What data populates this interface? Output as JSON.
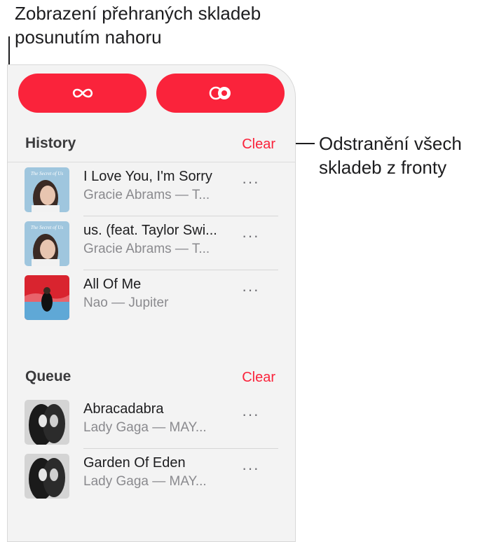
{
  "callouts": {
    "top": "Zobrazení přehraných skladeb posunutím nahoru",
    "right": "Odstranění všech skladeb z fronty"
  },
  "top_buttons": [
    {
      "icon": "infinity-icon"
    },
    {
      "icon": "autoplay-icon"
    }
  ],
  "history": {
    "title": "History",
    "clear_label": "Clear",
    "items": [
      {
        "title": "I Love You, I'm Sorry",
        "subtitle": "Gracie Abrams — T...",
        "more": "···"
      },
      {
        "title": "us. (feat. Taylor Swi...",
        "subtitle": "Gracie Abrams — T...",
        "more": "···"
      },
      {
        "title": "All Of Me",
        "subtitle": "Nao — Jupiter",
        "more": "···"
      }
    ]
  },
  "queue": {
    "title": "Queue",
    "clear_label": "Clear",
    "items": [
      {
        "title": "Abracadabra",
        "subtitle": "Lady Gaga — MAY...",
        "more": "···"
      },
      {
        "title": "Garden Of Eden",
        "subtitle": "Lady Gaga — MAY...",
        "more": "···"
      }
    ]
  },
  "colors": {
    "accent": "#fa233b",
    "panel_bg": "#f3f3f3",
    "secondary_text": "#8a8a8e"
  }
}
